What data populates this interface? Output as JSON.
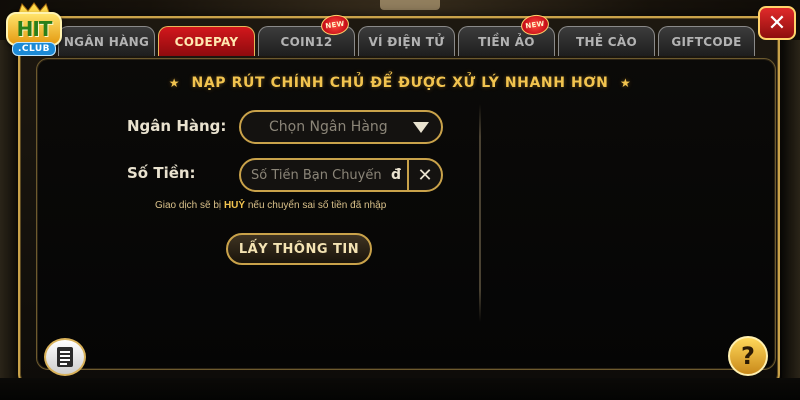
{
  "logo": {
    "main_text": "HIT",
    "club_text": ".CLUB"
  },
  "tabs": [
    {
      "label": "NGÂN HÀNG",
      "active": false,
      "new": false
    },
    {
      "label": "CODEPAY",
      "active": true,
      "new": false
    },
    {
      "label": "COIN12",
      "active": false,
      "new": true
    },
    {
      "label": "VÍ ĐIỆN TỬ",
      "active": false,
      "new": false
    },
    {
      "label": "TIỀN ẢO",
      "active": false,
      "new": true
    },
    {
      "label": "THẺ CÀO",
      "active": false,
      "new": false
    },
    {
      "label": "GIFTCODE",
      "active": false,
      "new": false
    }
  ],
  "badge_new": "NEW",
  "close_label": "✕",
  "title": {
    "star": "★",
    "text": "NẠP RÚT CHÍNH CHỦ ĐỂ ĐƯỢC XỬ LÝ NHANH HƠN"
  },
  "form": {
    "bank_label": "Ngân Hàng:",
    "bank_placeholder": "Chọn Ngân Hàng",
    "amount_label": "Số Tiền:",
    "amount_placeholder": "Số Tiền Bạn Chuyển",
    "currency": "đ",
    "clear_label": "✕",
    "warning_prefix": "Giao dịch sẽ bị ",
    "warning_bold": "HUỶ",
    "warning_suffix": " nếu chuyển sai số tiền đã nhập",
    "submit_label": "LẤY THÔNG TIN"
  },
  "help_label": "?",
  "colors": {
    "gold": "#c9a24a",
    "active_tab": "#d2171c",
    "title": "#f2c44f"
  }
}
